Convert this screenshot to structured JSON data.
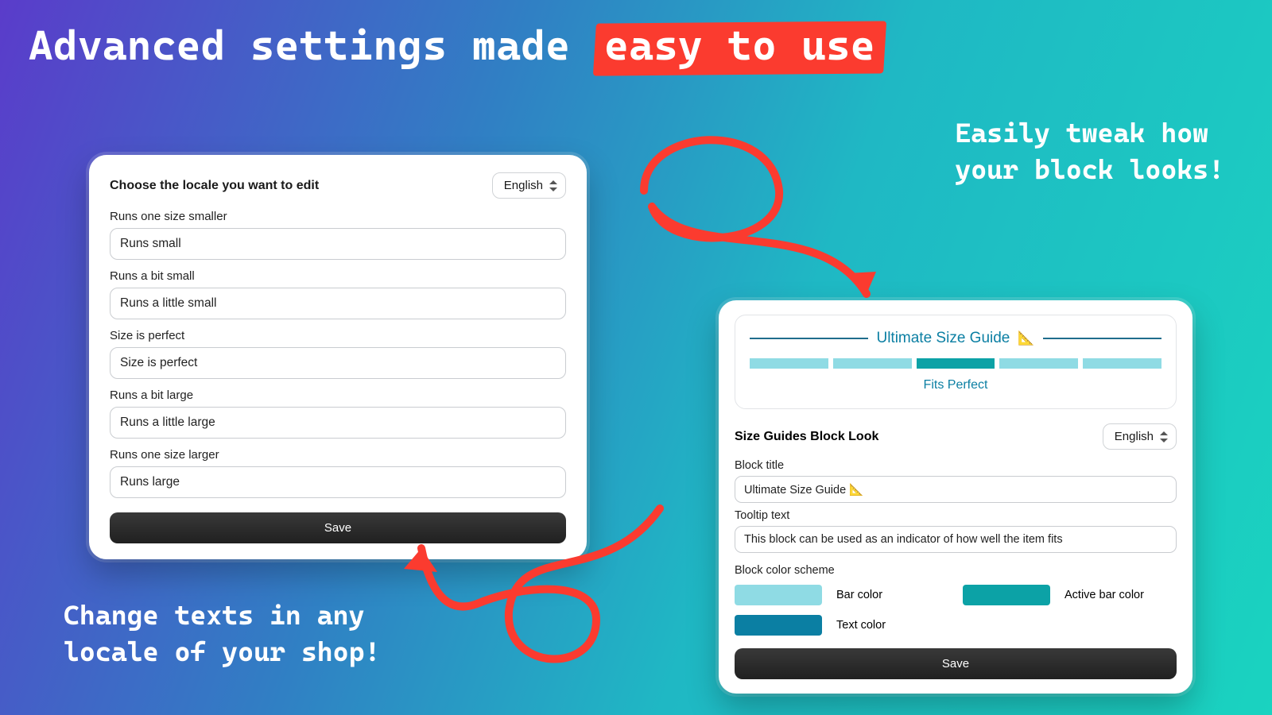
{
  "hero": {
    "prefix": "Advanced settings made ",
    "highlight": "easy to use"
  },
  "callouts": {
    "right": "Easily tweak how\nyour block looks!",
    "left": "Change texts in any\nlocale of your shop!"
  },
  "locale_panel": {
    "title": "Choose the locale you want to edit",
    "locale_value": "English",
    "fields": [
      {
        "label": "Runs one size smaller",
        "value": "Runs small"
      },
      {
        "label": "Runs a bit small",
        "value": "Runs a little small"
      },
      {
        "label": "Size is perfect",
        "value": "Size is perfect"
      },
      {
        "label": "Runs a bit large",
        "value": "Runs a little large"
      },
      {
        "label": "Runs one size larger",
        "value": "Runs large"
      }
    ],
    "save_label": "Save"
  },
  "look_panel": {
    "preview": {
      "title": "Ultimate Size Guide",
      "ruler": "📐",
      "active_index": 2,
      "bar_count": 5,
      "caption": "Fits Perfect"
    },
    "section_title": "Size Guides Block Look",
    "locale_value": "English",
    "block_title_label": "Block title",
    "block_title_value": "Ultimate Size Guide 📐",
    "tooltip_label": "Tooltip text",
    "tooltip_value": "This block can be used as an indicator of how well the item fits",
    "scheme_label": "Block color scheme",
    "colors": {
      "bar": {
        "hex": "#8fdbe4",
        "label": "Bar color"
      },
      "active": {
        "hex": "#0ca2a6",
        "label": "Active bar color"
      },
      "text": {
        "hex": "#0b7fa3",
        "label": "Text color"
      }
    },
    "save_label": "Save"
  }
}
